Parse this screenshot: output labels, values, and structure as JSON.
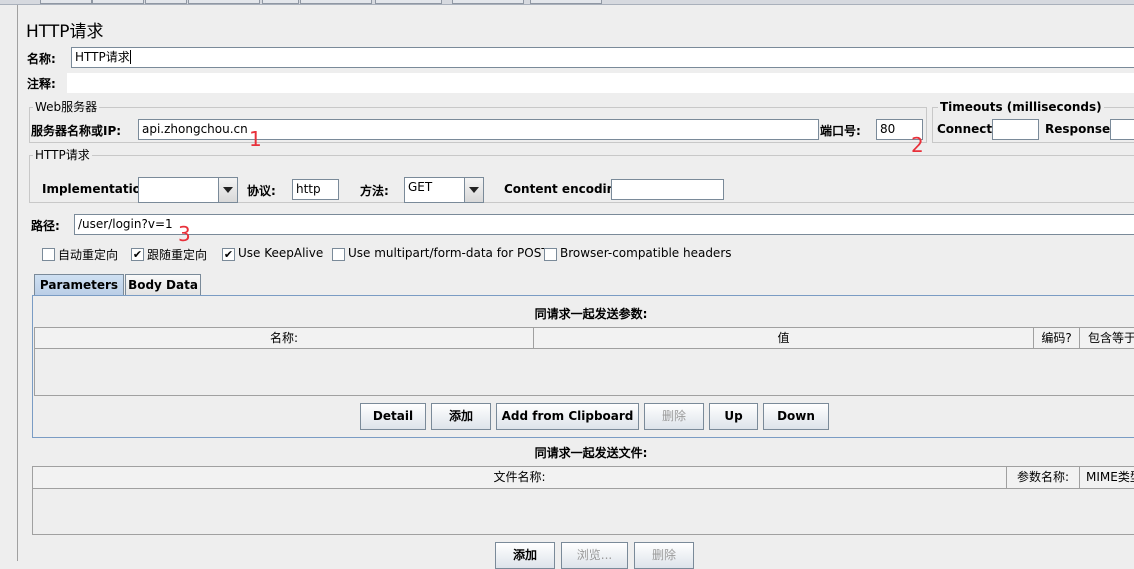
{
  "panel": {
    "title": "HTTP请求",
    "name_label": "名称:",
    "name_value": "HTTP请求",
    "comment_label": "注释:"
  },
  "web_server": {
    "group_title": "Web服务器",
    "server_label": "服务器名称或IP:",
    "server_value": "api.zhongchou.cn",
    "port_label": "端口号:",
    "port_value": "80"
  },
  "timeouts": {
    "group_title": "Timeouts (milliseconds)",
    "connect_label": "Connect:",
    "connect_value": "",
    "response_label": "Response:",
    "response_value": ""
  },
  "http_request": {
    "group_title": "HTTP请求",
    "implementation_label": "Implementation:",
    "implementation_value": "",
    "protocol_label": "协议:",
    "protocol_value": "http",
    "method_label": "方法:",
    "method_value": "GET",
    "encoding_label": "Content encoding:",
    "encoding_value": "",
    "path_label": "路径:",
    "path_value": "/user/login?v=1"
  },
  "options": [
    {
      "label": "自动重定向",
      "checked": false
    },
    {
      "label": "跟随重定向",
      "checked": true
    },
    {
      "label": "Use KeepAlive",
      "checked": true
    },
    {
      "label": "Use multipart/form-data for POST",
      "checked": false
    },
    {
      "label": "Browser-compatible headers",
      "checked": false
    }
  ],
  "tabs": [
    {
      "label": "Parameters",
      "selected": true
    },
    {
      "label": "Body Data",
      "selected": false
    }
  ],
  "parameters": {
    "caption": "同请求一起发送参数:",
    "columns": [
      "名称:",
      "值",
      "编码?",
      "包含等于"
    ],
    "buttons": [
      "Detail",
      "添加",
      "Add from Clipboard",
      "删除",
      "Up",
      "Down"
    ]
  },
  "files": {
    "caption": "同请求一起发送文件:",
    "columns": [
      "文件名称:",
      "参数名称:",
      "MIME类型"
    ],
    "buttons": [
      "添加",
      "浏览...",
      "删除"
    ]
  },
  "annotations": [
    "1",
    "2",
    "3"
  ],
  "check_mark": "✔",
  "colors": {
    "annotation": "#e8303a",
    "field_border": "#7a8a99",
    "background": "#eeeeee"
  }
}
